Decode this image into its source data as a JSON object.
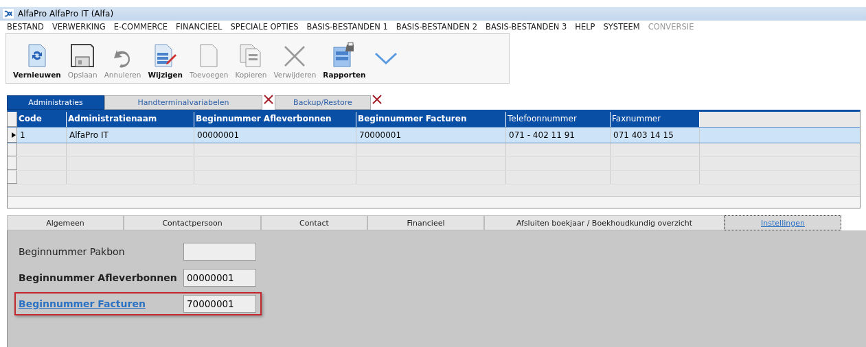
{
  "window": {
    "title": "AlfaPro AlfaPro IT (Alfa)"
  },
  "menu": [
    {
      "label": "BESTAND",
      "disabled": false
    },
    {
      "label": "VERWERKING",
      "disabled": false
    },
    {
      "label": "E-COMMERCE",
      "disabled": false
    },
    {
      "label": "FINANCIEEL",
      "disabled": false
    },
    {
      "label": "SPECIALE OPTIES",
      "disabled": false
    },
    {
      "label": "BASIS-BESTANDEN 1",
      "disabled": false
    },
    {
      "label": "BASIS-BESTANDEN 2",
      "disabled": false
    },
    {
      "label": "BASIS-BESTANDEN 3",
      "disabled": false
    },
    {
      "label": "HELP",
      "disabled": false
    },
    {
      "label": "SYSTEEM",
      "disabled": false
    },
    {
      "label": "CONVERSIE",
      "disabled": true
    }
  ],
  "toolbar": [
    {
      "kind": "refresh",
      "label": "Vernieuwen",
      "disabled": false
    },
    {
      "kind": "save",
      "label": "Opslaan",
      "disabled": true
    },
    {
      "kind": "undo",
      "label": "Annuleren",
      "disabled": true
    },
    {
      "kind": "edit",
      "label": "Wijzigen",
      "disabled": false
    },
    {
      "kind": "new",
      "label": "Toevoegen",
      "disabled": true
    },
    {
      "kind": "copy",
      "label": "Kopieren",
      "disabled": true
    },
    {
      "kind": "delete",
      "label": "Verwijderen",
      "disabled": true
    },
    {
      "kind": "report",
      "label": "Rapporten",
      "disabled": false
    }
  ],
  "tabs": [
    {
      "label": "Administraties",
      "selected": true,
      "closable": false
    },
    {
      "label": "Handterminalvariabelen",
      "selected": false,
      "closable": true
    },
    {
      "label": "Backup/Restore",
      "selected": false,
      "closable": true
    }
  ],
  "table": {
    "columns": [
      "Code",
      "Administratienaam",
      "Beginnummer Afleverbonnen",
      "Beginnummer Facturen",
      "Telefoonnummer",
      "Faxnummer"
    ],
    "rows": [
      {
        "selected": true,
        "cells": [
          "1",
          "AlfaPro IT",
          "00000001",
          "70000001",
          "071 - 402 11 91",
          "071 403 14 15"
        ]
      }
    ]
  },
  "detail_tabs": [
    {
      "label": "Algemeen",
      "selected": false
    },
    {
      "label": "Contactpersoon",
      "selected": false
    },
    {
      "label": "Contact",
      "selected": false
    },
    {
      "label": "Financieel",
      "selected": false
    },
    {
      "label": "Afsluiten boekjaar / Boekhoudkundig overzicht",
      "selected": false
    },
    {
      "label": "Instellingen",
      "selected": true
    }
  ],
  "fields": [
    {
      "kind": "plain",
      "label": "Beginnummer Pakbon",
      "highlighted": false
    },
    {
      "kind": "bold",
      "label": "Beginnummer Afleverbonnen",
      "value": "00000001",
      "highlighted": false
    },
    {
      "kind": "link",
      "label": "Beginnummer Facturen",
      "value": "70000001",
      "highlighted": true
    }
  ]
}
